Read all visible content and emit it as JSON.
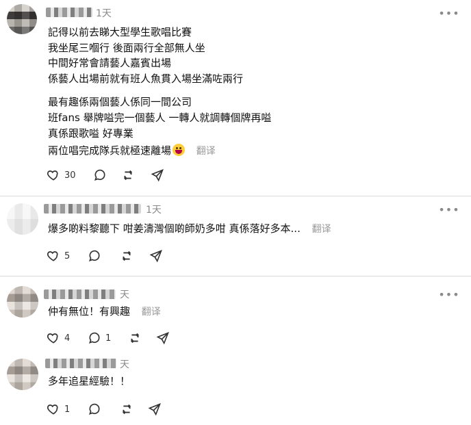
{
  "posts": [
    {
      "time": "1天",
      "lines": [
        "記得以前去睇大型學生歌唱比賽",
        "我坐尾三嗰行 後面兩行全部無人坐",
        "中間好常會請藝人嘉賓出場",
        "係藝人出場前就有班人魚貫入場坐滿咗兩行",
        "",
        "最有趣係兩個藝人係同一間公司",
        "班fans 舉牌嗌完一個藝人 一轉人就調轉個牌再嗌",
        "真係跟歌嗌 好專業",
        "兩位唱完成隊兵就極速離場"
      ],
      "translate": "翻译",
      "likes": "30"
    },
    {
      "time": "1天",
      "text": "爆多啲料黎聽下 咁姜濤灣個啲師奶多咁 真係落好多本...",
      "translate": "翻译",
      "likes": "5"
    },
    {
      "time": "天",
      "text": "仲有無位！有興趣",
      "translate": "翻译",
      "likes": "4",
      "replies": "1"
    },
    {
      "time": "天",
      "text": "多年追星經驗！！",
      "likes": "1"
    }
  ],
  "icons": {
    "like": "heart-icon",
    "reply": "comment-icon",
    "repost": "repost-icon",
    "share": "send-icon",
    "more": "more-icon"
  }
}
